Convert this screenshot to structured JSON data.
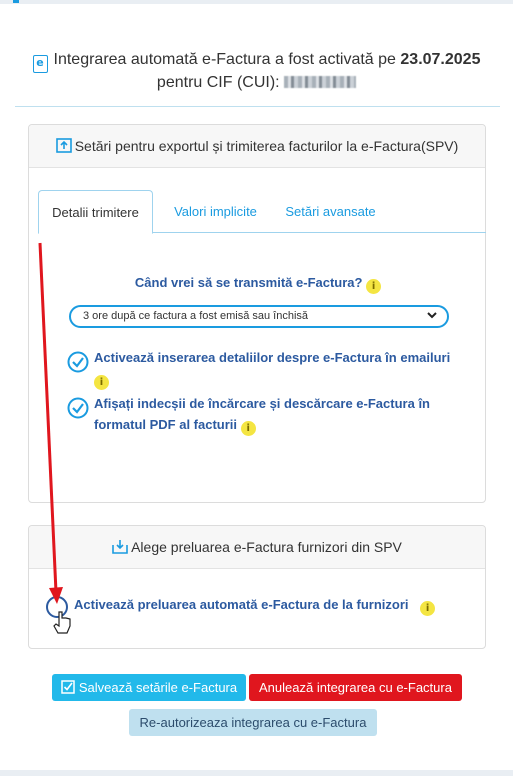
{
  "status": {
    "icon": "e-document-icon",
    "line1_prefix": "Integrarea automată e-Factura a fost activată pe",
    "date": "23.07.2025",
    "line2_prefix": "pentru CIF (CUI):"
  },
  "export_card": {
    "title": "Setări pentru exportul și trimiterea facturilor la e-Factura(SPV)",
    "icon": "upload-icon",
    "tabs": [
      {
        "label": "Detalii trimitere",
        "active": true
      },
      {
        "label": "Valori implicite",
        "active": false
      },
      {
        "label": "Setări avansate",
        "active": false
      }
    ],
    "question": "Când vrei să se transmită e-Factura?",
    "select_value": "3 ore după ce factura a fost emisă sau închisă",
    "options": [
      {
        "label": "Activează inserarea detaliilor despre e-Factura în emailuri",
        "checked": true
      },
      {
        "label_line1": "Afișați indecșii de încărcare și descărcare e-Factura în",
        "label_line2": "formatul PDF al facturii",
        "checked": true
      }
    ]
  },
  "import_card": {
    "title": "Alege preluarea e-Factura furnizori din SPV",
    "icon": "download-icon",
    "option": {
      "label": "Activează preluarea automată e-Factura de la furnizori",
      "checked": false
    }
  },
  "buttons": {
    "save": "Salvează setările e-Factura",
    "cancel": "Anulează integrarea cu e-Factura",
    "reauth": "Re-autorizeaza integrarea cu e-Factura"
  },
  "colors": {
    "accent": "#1a9be0",
    "label_blue": "#2c5aa0",
    "save": "#22b9ea",
    "cancel": "#e0161e",
    "reauth": "#bfe0ef",
    "info": "#f4e542",
    "annotation_arrow": "#e0161e"
  }
}
